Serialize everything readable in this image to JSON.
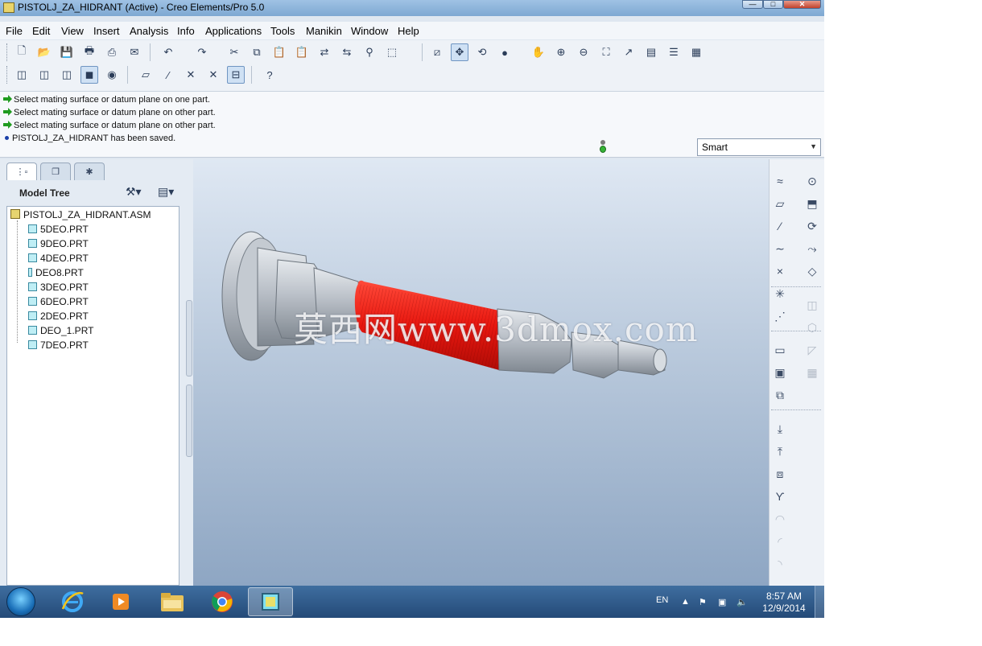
{
  "window": {
    "title": "PISTOLJ_ZA_HIDRANT (Active) - Creo Elements/Pro 5.0",
    "minimize_label": "—",
    "maximize_label": "□",
    "close_label": "✕"
  },
  "menu": [
    "File",
    "Edit",
    "View",
    "Insert",
    "Analysis",
    "Info",
    "Applications",
    "Tools",
    "Manikin",
    "Window",
    "Help"
  ],
  "toolbar": {
    "row1": [
      {
        "icon": "new-file-icon",
        "glyph": "🗋"
      },
      {
        "icon": "open-folder-icon",
        "glyph": "📂"
      },
      {
        "icon": "save-icon",
        "glyph": "💾"
      },
      {
        "icon": "print-icon",
        "glyph": "🖶"
      },
      {
        "icon": "print-preview-icon",
        "glyph": "⎙"
      },
      {
        "icon": "email-icon",
        "glyph": "✉"
      },
      {
        "icon": "undo-icon",
        "glyph": "↶"
      },
      {
        "icon": "redo-icon",
        "glyph": "↷"
      },
      {
        "icon": "cut-icon",
        "glyph": "✂"
      },
      {
        "icon": "copy-icon",
        "glyph": "⧉"
      },
      {
        "icon": "paste-icon",
        "glyph": "📋"
      },
      {
        "icon": "paste-special-icon",
        "glyph": "📋"
      },
      {
        "icon": "regenerate-icon",
        "glyph": "⇄"
      },
      {
        "icon": "regen-manager-icon",
        "glyph": "⇆"
      },
      {
        "icon": "find-icon",
        "glyph": "⚲"
      },
      {
        "icon": "selection-box-icon",
        "glyph": "⬚"
      },
      {
        "icon": "repaint-icon",
        "glyph": "⧄"
      },
      {
        "icon": "spin-center-icon",
        "glyph": "✥"
      },
      {
        "icon": "orient-mode-icon",
        "glyph": "⟲"
      },
      {
        "icon": "appearance-sphere-icon",
        "glyph": "●"
      },
      {
        "icon": "pan-hand-icon",
        "glyph": "✋"
      },
      {
        "icon": "zoom-in-icon",
        "glyph": "⊕"
      },
      {
        "icon": "zoom-out-icon",
        "glyph": "⊖"
      },
      {
        "icon": "refit-icon",
        "glyph": "⛶"
      },
      {
        "icon": "reorient-icon",
        "glyph": "↗"
      },
      {
        "icon": "saved-views-icon",
        "glyph": "▤"
      },
      {
        "icon": "layers-icon",
        "glyph": "☰"
      },
      {
        "icon": "view-manager-icon",
        "glyph": "▦"
      }
    ],
    "row2": [
      {
        "icon": "wireframe-icon",
        "glyph": "◫"
      },
      {
        "icon": "hidden-line-icon",
        "glyph": "◫"
      },
      {
        "icon": "no-hidden-icon",
        "glyph": "◫"
      },
      {
        "icon": "shading-icon",
        "glyph": "◼"
      },
      {
        "icon": "enhanced-realism-icon",
        "glyph": "◉"
      },
      {
        "icon": "datum-planes-display-icon",
        "glyph": "▱"
      },
      {
        "icon": "datum-axes-display-icon",
        "glyph": "⁄"
      },
      {
        "icon": "datum-points-display-icon",
        "glyph": "✕"
      },
      {
        "icon": "csys-display-icon",
        "glyph": "✕"
      },
      {
        "icon": "annotation-display-icon",
        "glyph": "⊟"
      },
      {
        "icon": "context-help-icon",
        "glyph": "?"
      }
    ]
  },
  "messages": [
    {
      "type": "prompt",
      "text": "Select mating surface or datum plane on one part."
    },
    {
      "type": "prompt",
      "text": "Select mating surface or datum plane on other part."
    },
    {
      "type": "prompt",
      "text": "Select mating surface or datum plane on other part."
    },
    {
      "type": "info",
      "text": "PISTOLJ_ZA_HIDRANT has been saved."
    }
  ],
  "filter": {
    "value": "Smart"
  },
  "model_tree": {
    "title": "Model Tree",
    "tabs": [
      {
        "icon": "model-tree-tab-icon",
        "glyph": "⋮▫"
      },
      {
        "icon": "folder-browser-tab-icon",
        "glyph": "❐"
      },
      {
        "icon": "favorites-tab-icon",
        "glyph": "✱"
      }
    ],
    "root": "PISTOLJ_ZA_HIDRANT.ASM",
    "items": [
      "5DEO.PRT",
      "9DEO.PRT",
      "4DEO.PRT",
      "DEO8.PRT",
      "3DEO.PRT",
      "6DEO.PRT",
      "2DEO.PRT",
      "DEO_1.PRT",
      "7DEO.PRT"
    ]
  },
  "viewport": {
    "watermark": "莫西网www.3dmox.com",
    "model_colors": {
      "body": "#b9bfc7",
      "hose": "#e8170f"
    }
  },
  "right_toolbar": [
    {
      "icon": "sketched-datum-curve-icon",
      "glyph": "≈"
    },
    {
      "icon": "datum-plane-icon",
      "glyph": "▱"
    },
    {
      "icon": "datum-axis-icon",
      "glyph": "⁄"
    },
    {
      "icon": "datum-curve-icon",
      "glyph": "∼"
    },
    {
      "icon": "datum-point-icon",
      "glyph": "×"
    },
    {
      "icon": "csys-icon",
      "glyph": "✳"
    },
    {
      "icon": "analysis-feature-icon",
      "glyph": "⋰"
    },
    {
      "icon": "new-component-icon",
      "glyph": "▭"
    },
    {
      "icon": "assemble-component-icon",
      "glyph": "▣"
    },
    {
      "icon": "create-component-icon",
      "glyph": "⧉"
    },
    {
      "icon": "merge-icon",
      "glyph": "⤓"
    },
    {
      "icon": "cut-out-icon",
      "glyph": "⤒"
    },
    {
      "icon": "inheritance-icon",
      "glyph": "⧈"
    },
    {
      "icon": "weld-icon",
      "glyph": "ϒ"
    },
    {
      "icon": "round-icon",
      "glyph": "◠"
    },
    {
      "icon": "chamfer-icon",
      "glyph": "◜"
    },
    {
      "icon": "shell-icon",
      "glyph": "◝"
    },
    {
      "icon": "hole-icon",
      "glyph": "⊙"
    },
    {
      "icon": "extrude-icon",
      "glyph": "⬒"
    },
    {
      "icon": "revolve-icon",
      "glyph": "⟳"
    },
    {
      "icon": "sweep-icon",
      "glyph": "⤳"
    },
    {
      "icon": "blend-icon",
      "glyph": "◇"
    },
    {
      "icon": "mirror-icon",
      "glyph": "◫"
    },
    {
      "icon": "trim-icon",
      "glyph": "⬡"
    },
    {
      "icon": "draft-icon",
      "glyph": "◸"
    },
    {
      "icon": "pattern-icon",
      "glyph": "▦"
    }
  ],
  "taskbar": {
    "language": "EN",
    "time": "8:57 AM",
    "date": "12/9/2014",
    "apps": [
      {
        "icon": "internet-explorer-icon"
      },
      {
        "icon": "media-player-icon"
      },
      {
        "icon": "file-explorer-icon"
      },
      {
        "icon": "chrome-icon"
      },
      {
        "icon": "creo-taskbar-icon",
        "active": true
      }
    ]
  }
}
